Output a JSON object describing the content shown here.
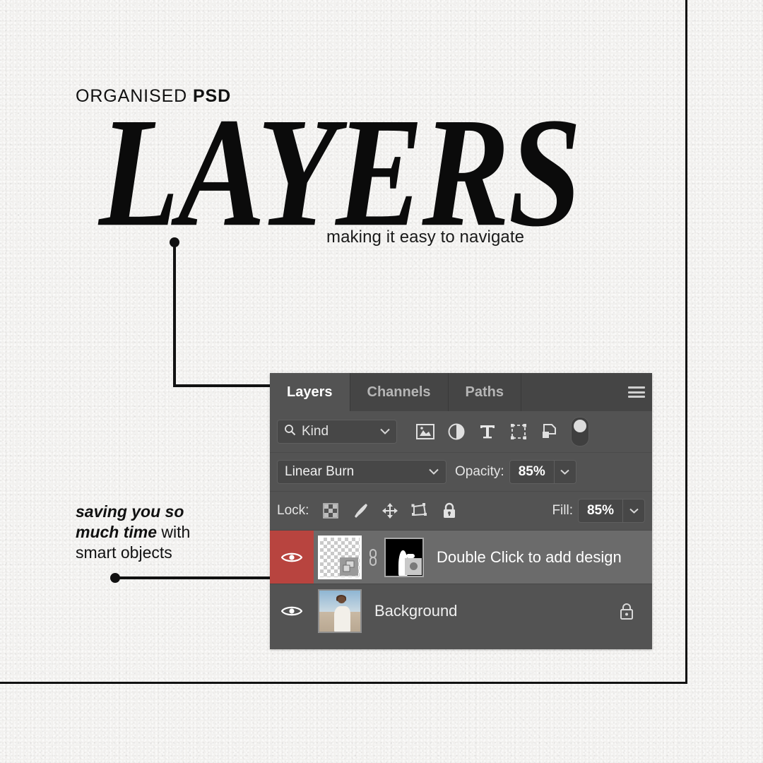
{
  "page": {
    "background_color": "#f2f1ef",
    "frame_color": "#111111"
  },
  "headline": {
    "eyebrow_light": "ORGANISED ",
    "eyebrow_bold": "PSD",
    "title": "LAYERS",
    "subtitle": "making it easy to navigate"
  },
  "callouts": [
    {
      "name": "panel-callout",
      "text": ""
    },
    {
      "name": "smart-object-callout",
      "line1_bold": "saving you so",
      "line2_bold": "much time",
      "line2_rest": " with",
      "line3": "smart objects"
    }
  ],
  "photoshop_panel": {
    "tabs": [
      {
        "label": "Layers",
        "active": true
      },
      {
        "label": "Channels",
        "active": false
      },
      {
        "label": "Paths",
        "active": false
      }
    ],
    "menu_icon": "hamburger-menu-icon",
    "filter_row": {
      "search_icon": "search-icon",
      "kind_label": "Kind",
      "kind_caret": "chevron-down-icon",
      "filter_icons": [
        "image-filter-icon",
        "adjustment-filter-icon",
        "type-filter-icon",
        "shape-filter-icon",
        "smart-object-filter-icon"
      ],
      "toggle_icon": "filter-toggle-switch"
    },
    "blend_row": {
      "blend_mode": "Linear Burn",
      "blend_caret": "chevron-down-icon",
      "opacity_label": "Opacity:",
      "opacity_value": "85%",
      "opacity_caret": "chevron-down-icon"
    },
    "lock_row": {
      "lock_label": "Lock:",
      "lock_icons": [
        "lock-transparency-icon",
        "lock-brush-icon",
        "lock-move-icon",
        "lock-artboard-icon",
        "lock-all-icon"
      ],
      "fill_label": "Fill:",
      "fill_value": "85%",
      "fill_caret": "chevron-down-icon"
    },
    "layers": [
      {
        "name": "Double Click to add design",
        "selected": true,
        "visible": true,
        "visibility_highlight_color": "#b8443f",
        "eye_icon": "eye-visibility-icon",
        "thumbnail": "smart-object-thumbnail",
        "link_icon": "link-mask-icon",
        "mask_thumbnail": "layer-mask-thumbnail",
        "locked": false
      },
      {
        "name": "Background",
        "selected": false,
        "visible": true,
        "eye_icon": "eye-visibility-icon",
        "thumbnail": "background-photo-thumbnail",
        "locked": true,
        "lock_icon": "padlock-icon"
      }
    ],
    "colors": {
      "panel_bg": "#535353",
      "tabbar_bg": "#454545",
      "selected_row": "#6b6b6b",
      "accent_red": "#b8443f",
      "text": "#ffffff"
    }
  }
}
